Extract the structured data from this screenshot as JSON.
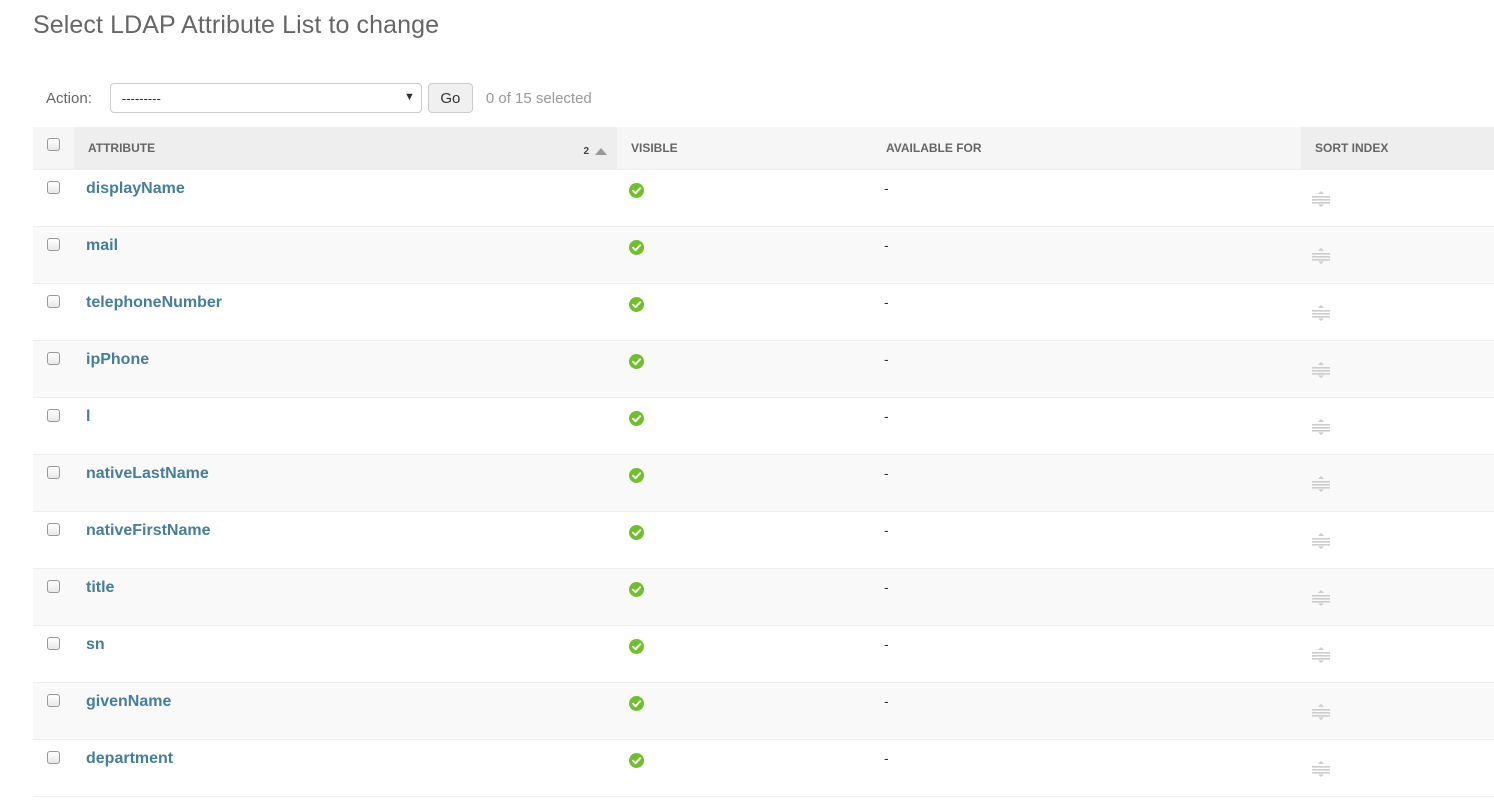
{
  "page": {
    "title": "Select LDAP Attribute List to change"
  },
  "actions": {
    "label": "Action:",
    "select_value": "---------",
    "go_label": "Go",
    "counter": "0 of 15 selected"
  },
  "table": {
    "columns": {
      "attribute": "Attribute",
      "visible": "Visible",
      "available_for": "Available for",
      "sort_index": "Sort index"
    },
    "sort_priority": "2",
    "rows": [
      {
        "attribute": "displayName",
        "visible": true,
        "available_for": "-"
      },
      {
        "attribute": "mail",
        "visible": true,
        "available_for": "-"
      },
      {
        "attribute": "telephoneNumber",
        "visible": true,
        "available_for": "-"
      },
      {
        "attribute": "ipPhone",
        "visible": true,
        "available_for": "-"
      },
      {
        "attribute": "l",
        "visible": true,
        "available_for": "-"
      },
      {
        "attribute": "nativeLastName",
        "visible": true,
        "available_for": "-"
      },
      {
        "attribute": "nativeFirstName",
        "visible": true,
        "available_for": "-"
      },
      {
        "attribute": "title",
        "visible": true,
        "available_for": "-"
      },
      {
        "attribute": "sn",
        "visible": true,
        "available_for": "-"
      },
      {
        "attribute": "givenName",
        "visible": true,
        "available_for": "-"
      },
      {
        "attribute": "department",
        "visible": true,
        "available_for": "-"
      }
    ]
  },
  "colors": {
    "link": "#447e9b",
    "visible_icon": "#70bf2b",
    "header_bg": "#f6f6f6",
    "handle": "#cccccc"
  },
  "icons": {
    "visible": "check-circle-icon",
    "sort": "sort-ascending-icon",
    "handle": "drag-handle-icon",
    "select": "chevron-down-icon"
  }
}
